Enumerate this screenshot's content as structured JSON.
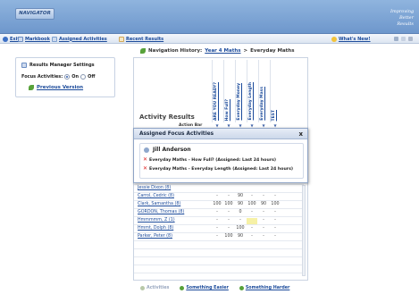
{
  "header": {
    "logo": "NAVIGATOR",
    "tagline": "Improving Better Results",
    "brand_color": "#6e97cc"
  },
  "toolbar": {
    "exit": "Exit",
    "markbook": "Markbook",
    "assigned": "Assigned Activities",
    "recent": "Recent Results",
    "whats_new": "What's New!"
  },
  "settings": {
    "title": "Results Manager Settings",
    "focus_label": "Focus Activities:",
    "on_label": "On",
    "off_label": "Off",
    "focus_on": true,
    "previous_version": "Previous Version"
  },
  "nav_history": {
    "label": "Navigation History:",
    "crumbs": [
      "Year 4 Maths",
      "Everyday Maths"
    ],
    "separator": ">"
  },
  "results": {
    "title": "Activity Results",
    "action_bar": "Action Bar",
    "columns": [
      "ARE YOU READY?",
      "How Full?",
      "Everyday Money",
      "Everyday Length",
      "Everyday Mass",
      "TEST"
    ],
    "arrow": "▼",
    "partial_row": "Jessie Dixon (8)",
    "rows": [
      {
        "name": "Carrol, Cedric (8)",
        "scores": [
          "-",
          "-",
          "90",
          "-",
          "-",
          "-"
        ]
      },
      {
        "name": "Clark, Samantha (8)",
        "scores": [
          "100",
          "100",
          "90",
          "100",
          "90",
          "100"
        ]
      },
      {
        "name": "GORDON, Thomas (8)",
        "scores": [
          "-",
          "-",
          "0",
          "-",
          "-",
          "-"
        ]
      },
      {
        "name": "Hmmmmm, Z (1)",
        "scores": [
          "-",
          "-",
          "-",
          "",
          "-",
          "-"
        ]
      },
      {
        "name": "Hmmt, Dolph (8)",
        "scores": [
          "-",
          "-",
          "100",
          "-",
          "-",
          "-"
        ]
      },
      {
        "name": "Parker, Peter (8)",
        "scores": [
          "-",
          "100",
          "90",
          "-",
          "-",
          "-"
        ]
      }
    ]
  },
  "bottom_actions": {
    "activities": "Activities",
    "easier": "Something Easier",
    "harder": "Something Harder"
  },
  "dialog": {
    "title": "Assigned Focus Activities",
    "close": "x",
    "student": "Jill Anderson",
    "items": [
      "Everyday Maths - How Full? (Assigned: Last 24 hours)",
      "Everyday Maths - Everyday Length (Assigned: Last 24 hours)"
    ]
  }
}
